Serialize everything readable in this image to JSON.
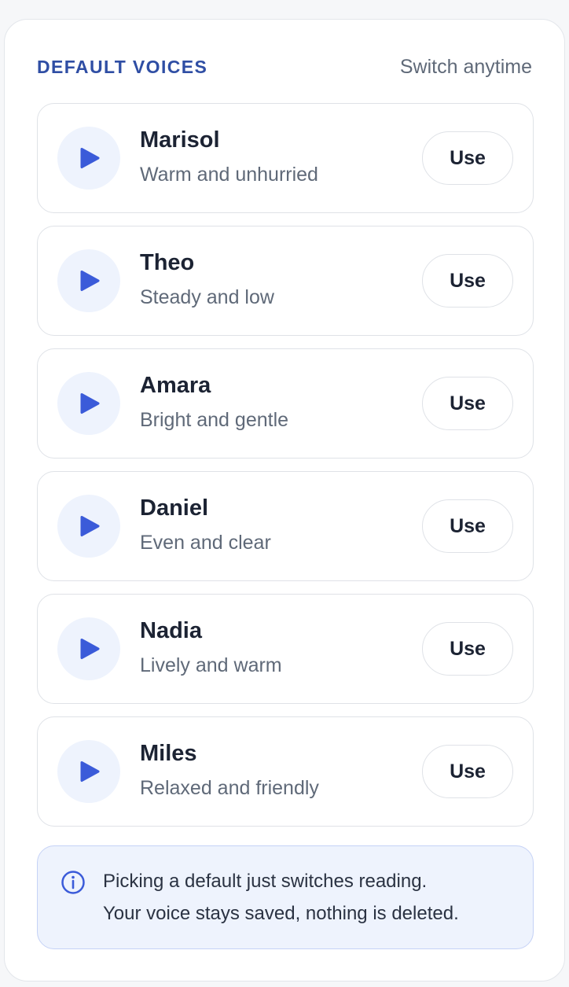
{
  "header": {
    "title": "DEFAULT VOICES",
    "hint": "Switch anytime"
  },
  "voices": [
    {
      "name": "Marisol",
      "description": "Warm and unhurried",
      "action_label": "Use"
    },
    {
      "name": "Theo",
      "description": "Steady and low",
      "action_label": "Use"
    },
    {
      "name": "Amara",
      "description": "Bright and gentle",
      "action_label": "Use"
    },
    {
      "name": "Daniel",
      "description": "Even and clear",
      "action_label": "Use"
    },
    {
      "name": "Nadia",
      "description": "Lively and warm",
      "action_label": "Use"
    },
    {
      "name": "Miles",
      "description": "Relaxed and friendly",
      "action_label": "Use"
    }
  ],
  "info": {
    "icon": "info-icon",
    "line1": "Picking a default just switches reading.",
    "line2": "Your voice stays saved, nothing is deleted."
  },
  "colors": {
    "accent": "#3b5bd9",
    "title": "#2f4ea4",
    "play_bg": "#eef3fd",
    "info_bg": "#eef3fd",
    "info_border": "#c5d2f6"
  }
}
